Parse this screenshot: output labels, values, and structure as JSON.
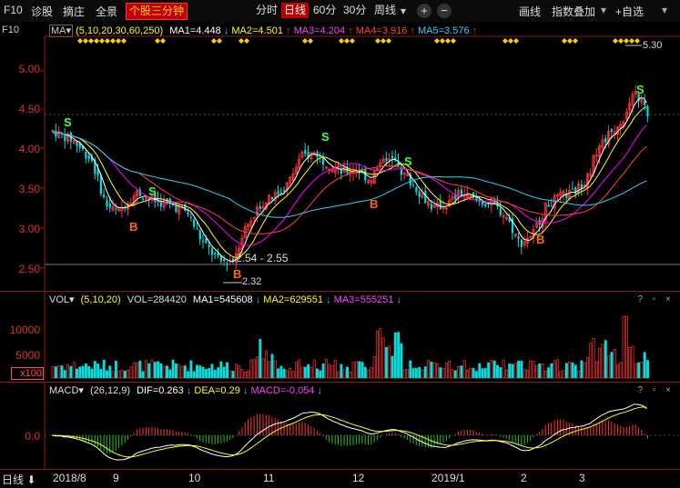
{
  "toolbar": {
    "f10": "F10",
    "diagnose": "诊股",
    "dig": "摘庄",
    "panorama": "全景",
    "stock_3min": "个股三分钟",
    "periods": [
      "分时",
      "日线",
      "60分",
      "30分",
      "周线"
    ],
    "selected_period": "日线",
    "period_menu_arrow": "▾",
    "zoom_in": "+",
    "zoom_out": "−",
    "draw_line": "画线",
    "index_overlay": "指数叠加",
    "self_select": "+自选"
  },
  "ma_legend": {
    "name": "MA▾",
    "params": "(5,10,20,30,60,250)",
    "ma1": "MA1=4.448",
    "ma2": "MA2=4.501",
    "ma3": "MA3=4.204",
    "ma4": "MA4=3.916",
    "ma5": "MA5=3.576"
  },
  "vol_legend": {
    "name": "VOL▾",
    "params": "(5,10,20)",
    "vol": "VOL=284420",
    "ma1": "MA1=545608",
    "ma2": "MA2=629551",
    "ma3": "MA3=555251"
  },
  "macd_legend": {
    "name": "MACD▾",
    "params": "(26,12,9)",
    "dif": "DIF=0.263",
    "dea": "DEA=0.29",
    "macd": "MACD=-0.054"
  },
  "price_axis": [
    "5.00",
    "4.50",
    "4.00",
    "3.50",
    "3.00",
    "2.50"
  ],
  "vol_axis": [
    "10000",
    "5000",
    "x100"
  ],
  "macd_axis": [
    "0.0"
  ],
  "annotations": {
    "high": "5.30",
    "low": "2.32",
    "support": "2.54 - 2.55",
    "buy": "B",
    "sell": "S"
  },
  "x_axis": {
    "period_label": "日线",
    "months": [
      "2018/8",
      "9",
      "10",
      "11",
      "12",
      "2019/1",
      "2",
      "3"
    ]
  },
  "colors": {
    "up": "#ff3232",
    "down": "#00e0e0",
    "ma1": "#ffffff",
    "ma2": "#ffff00",
    "ma3": "#ff00ff",
    "ma4": "#ff4040",
    "ma5": "#2ad0ff",
    "buy": "#ff6a00",
    "sell": "#40ff40"
  },
  "panel_icons": "? ▫ ×"
}
